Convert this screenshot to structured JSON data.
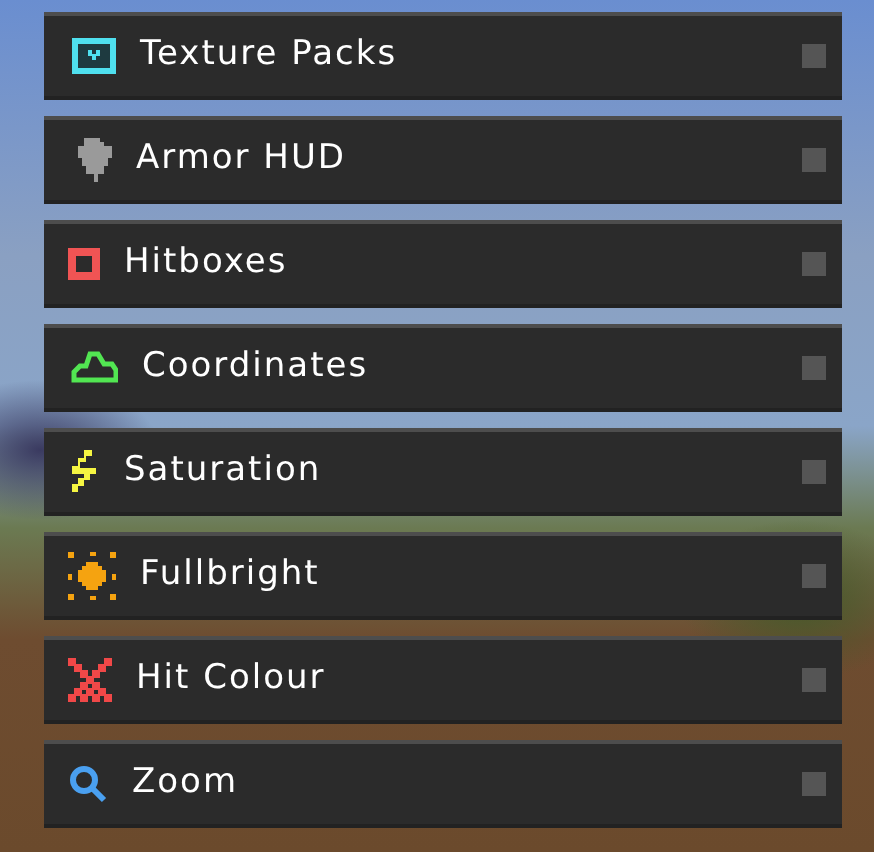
{
  "modules": [
    {
      "label": "Texture Packs",
      "enabled": false
    },
    {
      "label": "Armor HUD",
      "enabled": false
    },
    {
      "label": "Hitboxes",
      "enabled": false
    },
    {
      "label": "Coordinates",
      "enabled": false
    },
    {
      "label": "Saturation",
      "enabled": false
    },
    {
      "label": "Fullbright",
      "enabled": false
    },
    {
      "label": "Hit Colour",
      "enabled": false
    },
    {
      "label": "Zoom",
      "enabled": false
    }
  ]
}
